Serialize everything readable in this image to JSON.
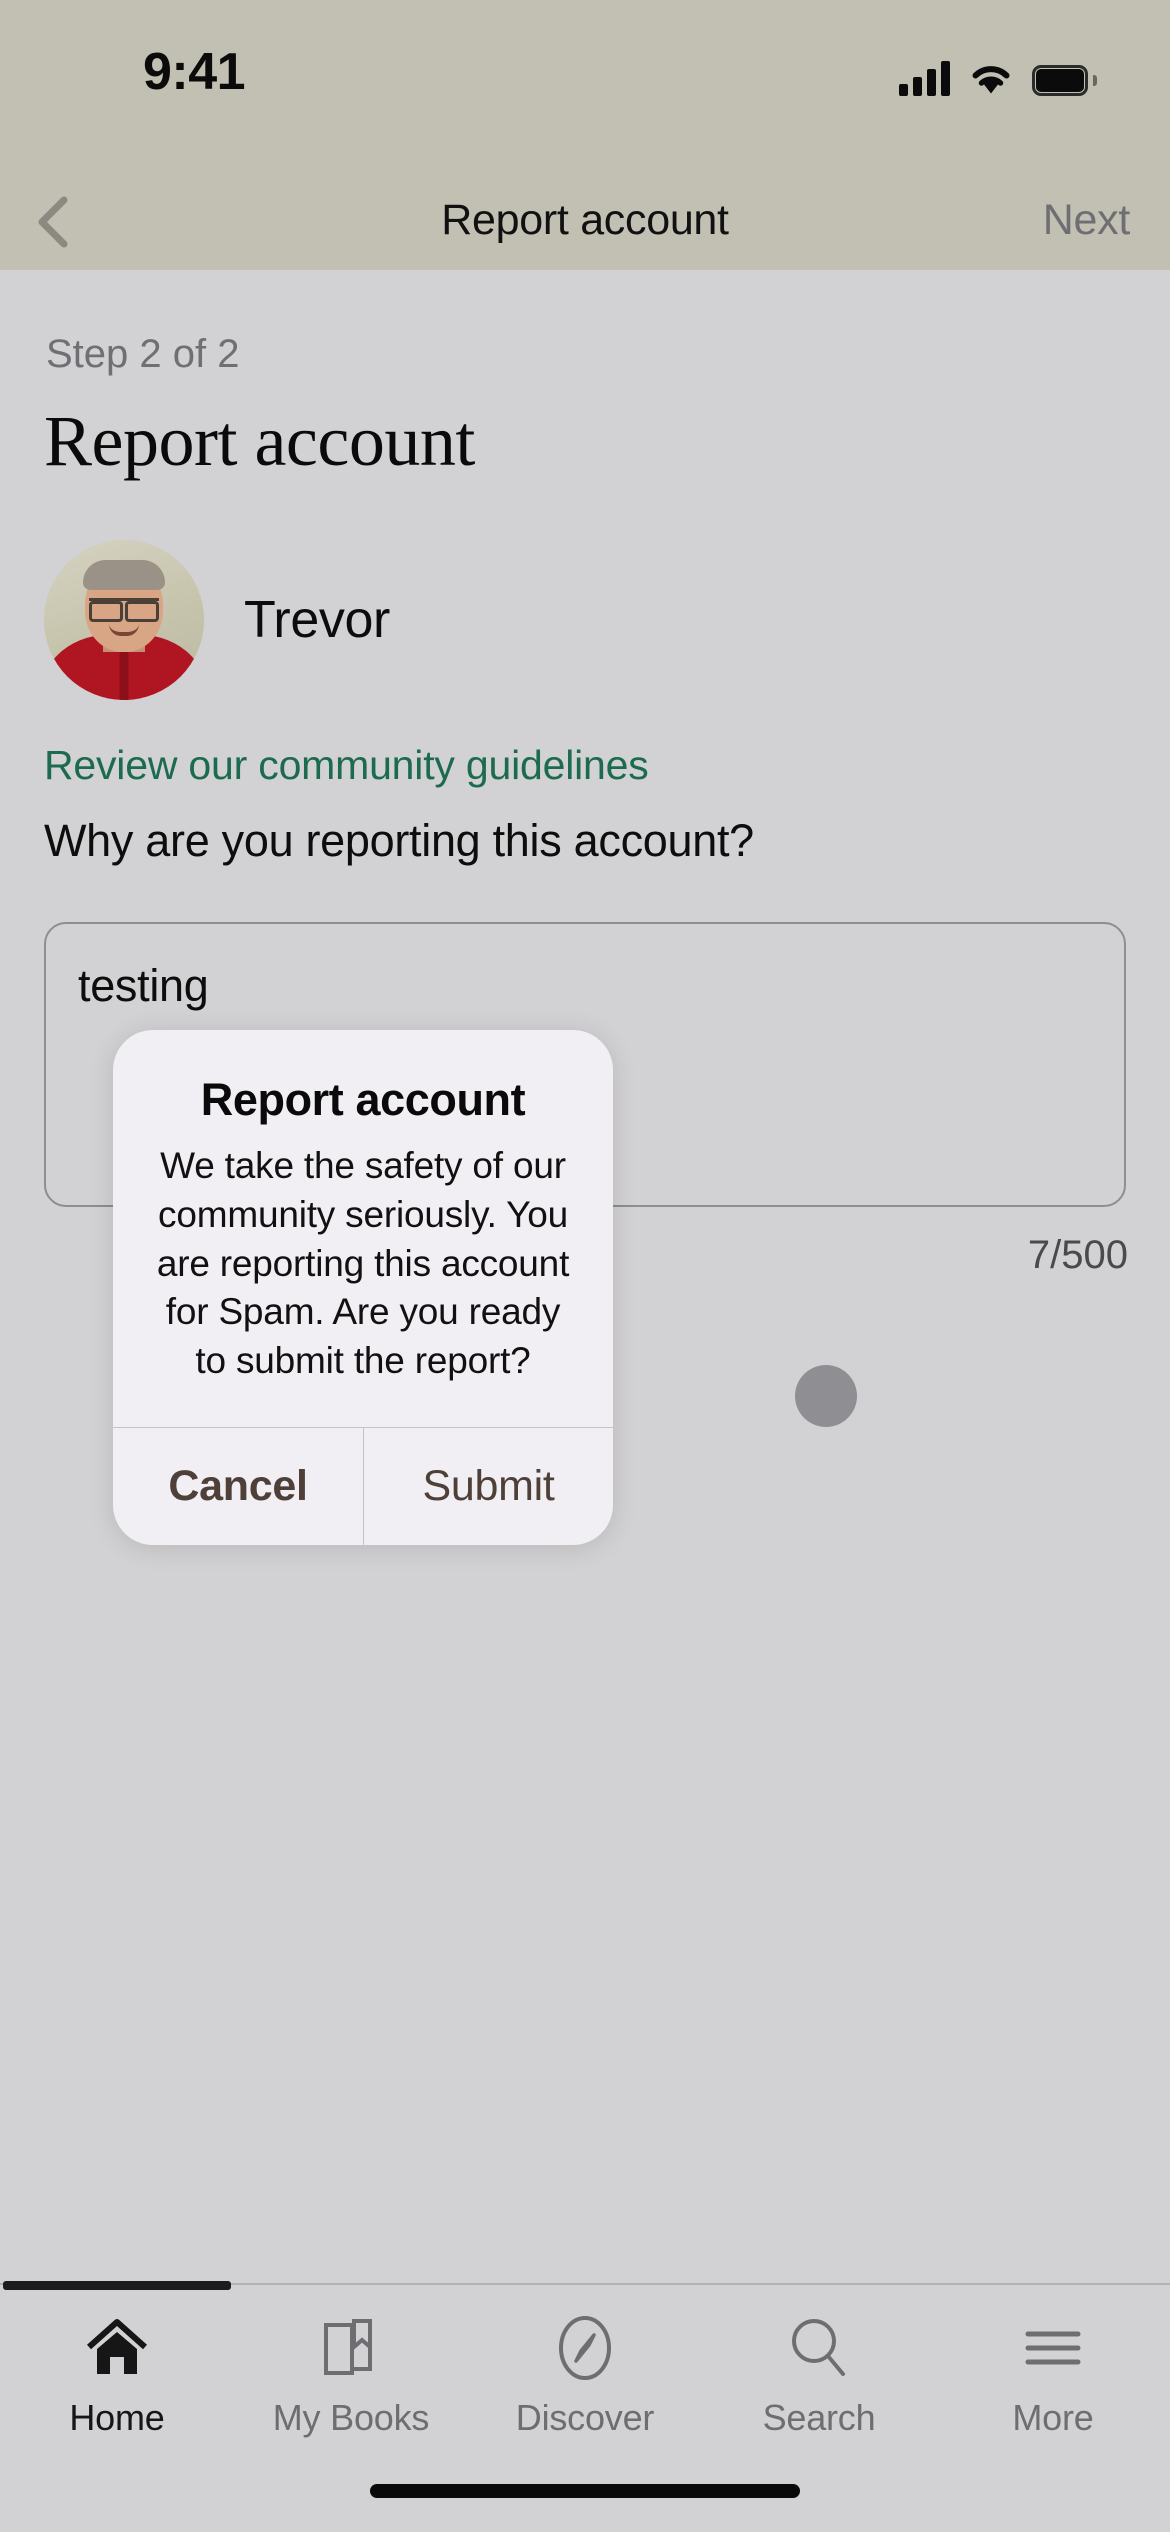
{
  "status_bar": {
    "time": "9:41",
    "cellular_icon": "signal-bars-icon",
    "wifi_icon": "wifi-icon",
    "battery_icon": "battery-full-icon"
  },
  "nav_bar": {
    "back_icon": "chevron-left-icon",
    "title": "Report account",
    "next_label": "Next"
  },
  "content": {
    "step_label": "Step 2 of 2",
    "page_title": "Report account",
    "account_name": "Trevor",
    "avatar_icon": "user-avatar-photo",
    "guidelines_link": "Review our community guidelines",
    "question": "Why are you reporting this account?",
    "reason_value": "testing",
    "reason_placeholder": "",
    "char_counter": "7/500"
  },
  "alert": {
    "title": "Report account",
    "message": "We take the safety of our community seriously. You are reporting this account for Spam. Are you ready to submit the report?",
    "cancel_label": "Cancel",
    "submit_label": "Submit"
  },
  "tab_bar": {
    "items": [
      {
        "label": "Home",
        "icon": "home-icon",
        "active": true
      },
      {
        "label": "My Books",
        "icon": "books-icon",
        "active": false
      },
      {
        "label": "Discover",
        "icon": "compass-icon",
        "active": false
      },
      {
        "label": "Search",
        "icon": "search-icon",
        "active": false
      },
      {
        "label": "More",
        "icon": "hamburger-icon",
        "active": false
      }
    ]
  },
  "colors": {
    "nav_background": "#c2c0b2",
    "page_background": "#d2d1d3",
    "link_green": "#1d6b4f",
    "alert_background": "#f1eff3",
    "alert_button_text": "#4e4039",
    "touch_dot": "#8e8e93"
  }
}
